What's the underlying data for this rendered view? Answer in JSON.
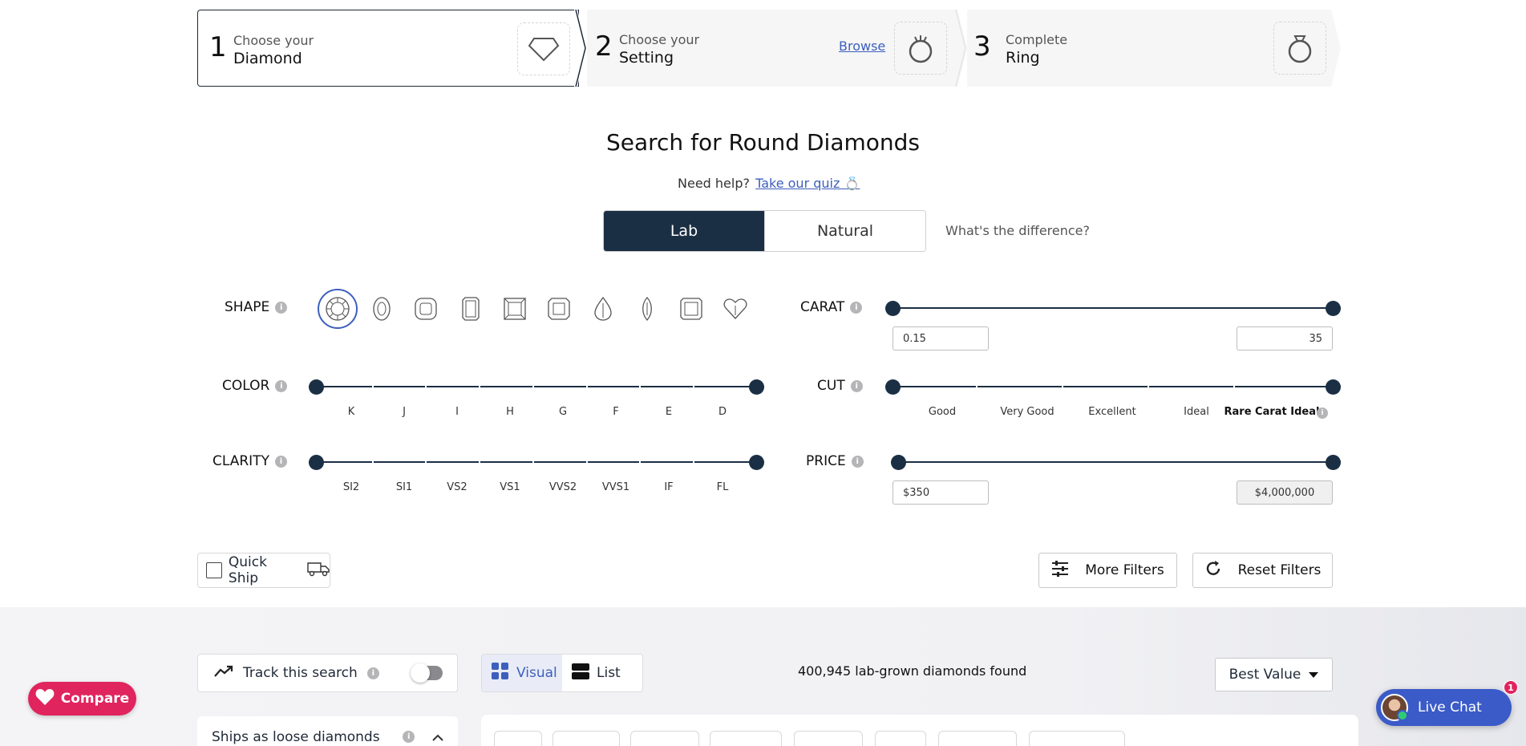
{
  "steps": [
    {
      "num": "1",
      "small": "Choose your",
      "big": "Diamond"
    },
    {
      "num": "2",
      "small": "Choose your",
      "big": "Setting",
      "link": "Browse"
    },
    {
      "num": "3",
      "small": "Complete",
      "big": "Ring"
    }
  ],
  "title": "Search for Round Diamonds",
  "help": {
    "text": "Need help?",
    "link": "Take our quiz 💍"
  },
  "type_toggle": {
    "lab": "Lab",
    "natural": "Natural",
    "selected": "Lab",
    "difference_link": "What's the difference?"
  },
  "filters": {
    "shape": {
      "label": "SHAPE",
      "selected": "round",
      "shapes": [
        "round",
        "oval",
        "cushion",
        "emerald",
        "princess",
        "asscher",
        "pear",
        "marquise",
        "radiant",
        "heart"
      ]
    },
    "carat": {
      "label": "CARAT",
      "min": "0.15",
      "max": "35"
    },
    "color": {
      "label": "COLOR",
      "grades": [
        "K",
        "J",
        "I",
        "H",
        "G",
        "F",
        "E",
        "D"
      ]
    },
    "cut": {
      "label": "CUT",
      "grades": [
        "Good",
        "Very Good",
        "Excellent",
        "Ideal",
        "Rare Carat Ideal"
      ]
    },
    "clarity": {
      "label": "CLARITY",
      "grades": [
        "SI2",
        "SI1",
        "VS2",
        "VS1",
        "VVS2",
        "VVS1",
        "IF",
        "FL"
      ]
    },
    "price": {
      "label": "PRICE",
      "min": "$350",
      "max": "$4,000,000"
    }
  },
  "quick_ship": {
    "label": "Quick Ship",
    "checked": false
  },
  "buttons": {
    "more_filters": "More Filters",
    "reset_filters": "Reset Filters"
  },
  "results": {
    "track_search": "Track this search",
    "track_enabled": false,
    "view_visual": "Visual",
    "view_list": "List",
    "view_selected": "Visual",
    "count_text": "400,945 lab-grown diamonds found",
    "sort": "Best Value",
    "ships_as": "Ships as loose diamonds by"
  },
  "compare_label": "Compare",
  "live_chat": {
    "label": "Live Chat",
    "badge": "1"
  },
  "colors": {
    "navy": "#1b2f44",
    "accent_blue": "#3d5fbd",
    "compare_pink": "#e0245e",
    "chat_blue": "#3a5bc8"
  }
}
